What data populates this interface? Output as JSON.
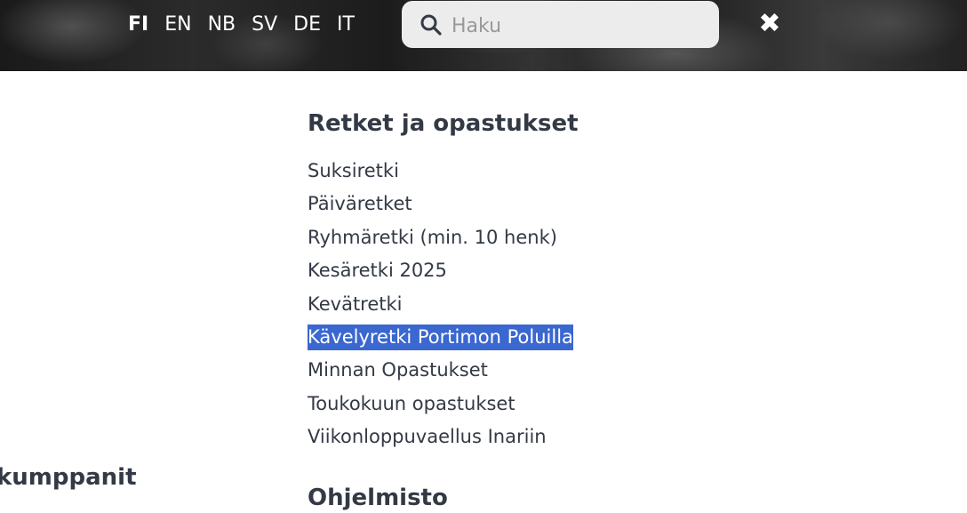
{
  "header": {
    "languages": [
      {
        "code": "FI",
        "active": true
      },
      {
        "code": "EN",
        "active": false
      },
      {
        "code": "NB",
        "active": false
      },
      {
        "code": "SV",
        "active": false
      },
      {
        "code": "DE",
        "active": false
      },
      {
        "code": "IT",
        "active": false
      }
    ],
    "search": {
      "placeholder": "Haku",
      "value": "",
      "icon": "search-icon"
    },
    "close_icon": "close-icon"
  },
  "main": {
    "section_title": "Retket ja opastukset",
    "items": [
      {
        "label": "Suksiretki"
      },
      {
        "label": "Päiväretket"
      },
      {
        "label": "Ryhmäretki (min. 10 henk)"
      },
      {
        "label": "Kesäretki 2025"
      },
      {
        "label": "Kevätretki"
      },
      {
        "label": "Kävelyretki Portimon Poluilla",
        "selected": true
      },
      {
        "label": "Minnan Opastukset"
      },
      {
        "label": "Toukokuun opastukset"
      },
      {
        "label": "Viikonloppuvaellus Inariin"
      }
    ],
    "next_section_title": "Ohjelmisto"
  },
  "left": {
    "partners_title": "kumppanit"
  },
  "colors": {
    "selection": "#3a67d0",
    "text": "#333a45",
    "search_bg": "#ececec"
  }
}
